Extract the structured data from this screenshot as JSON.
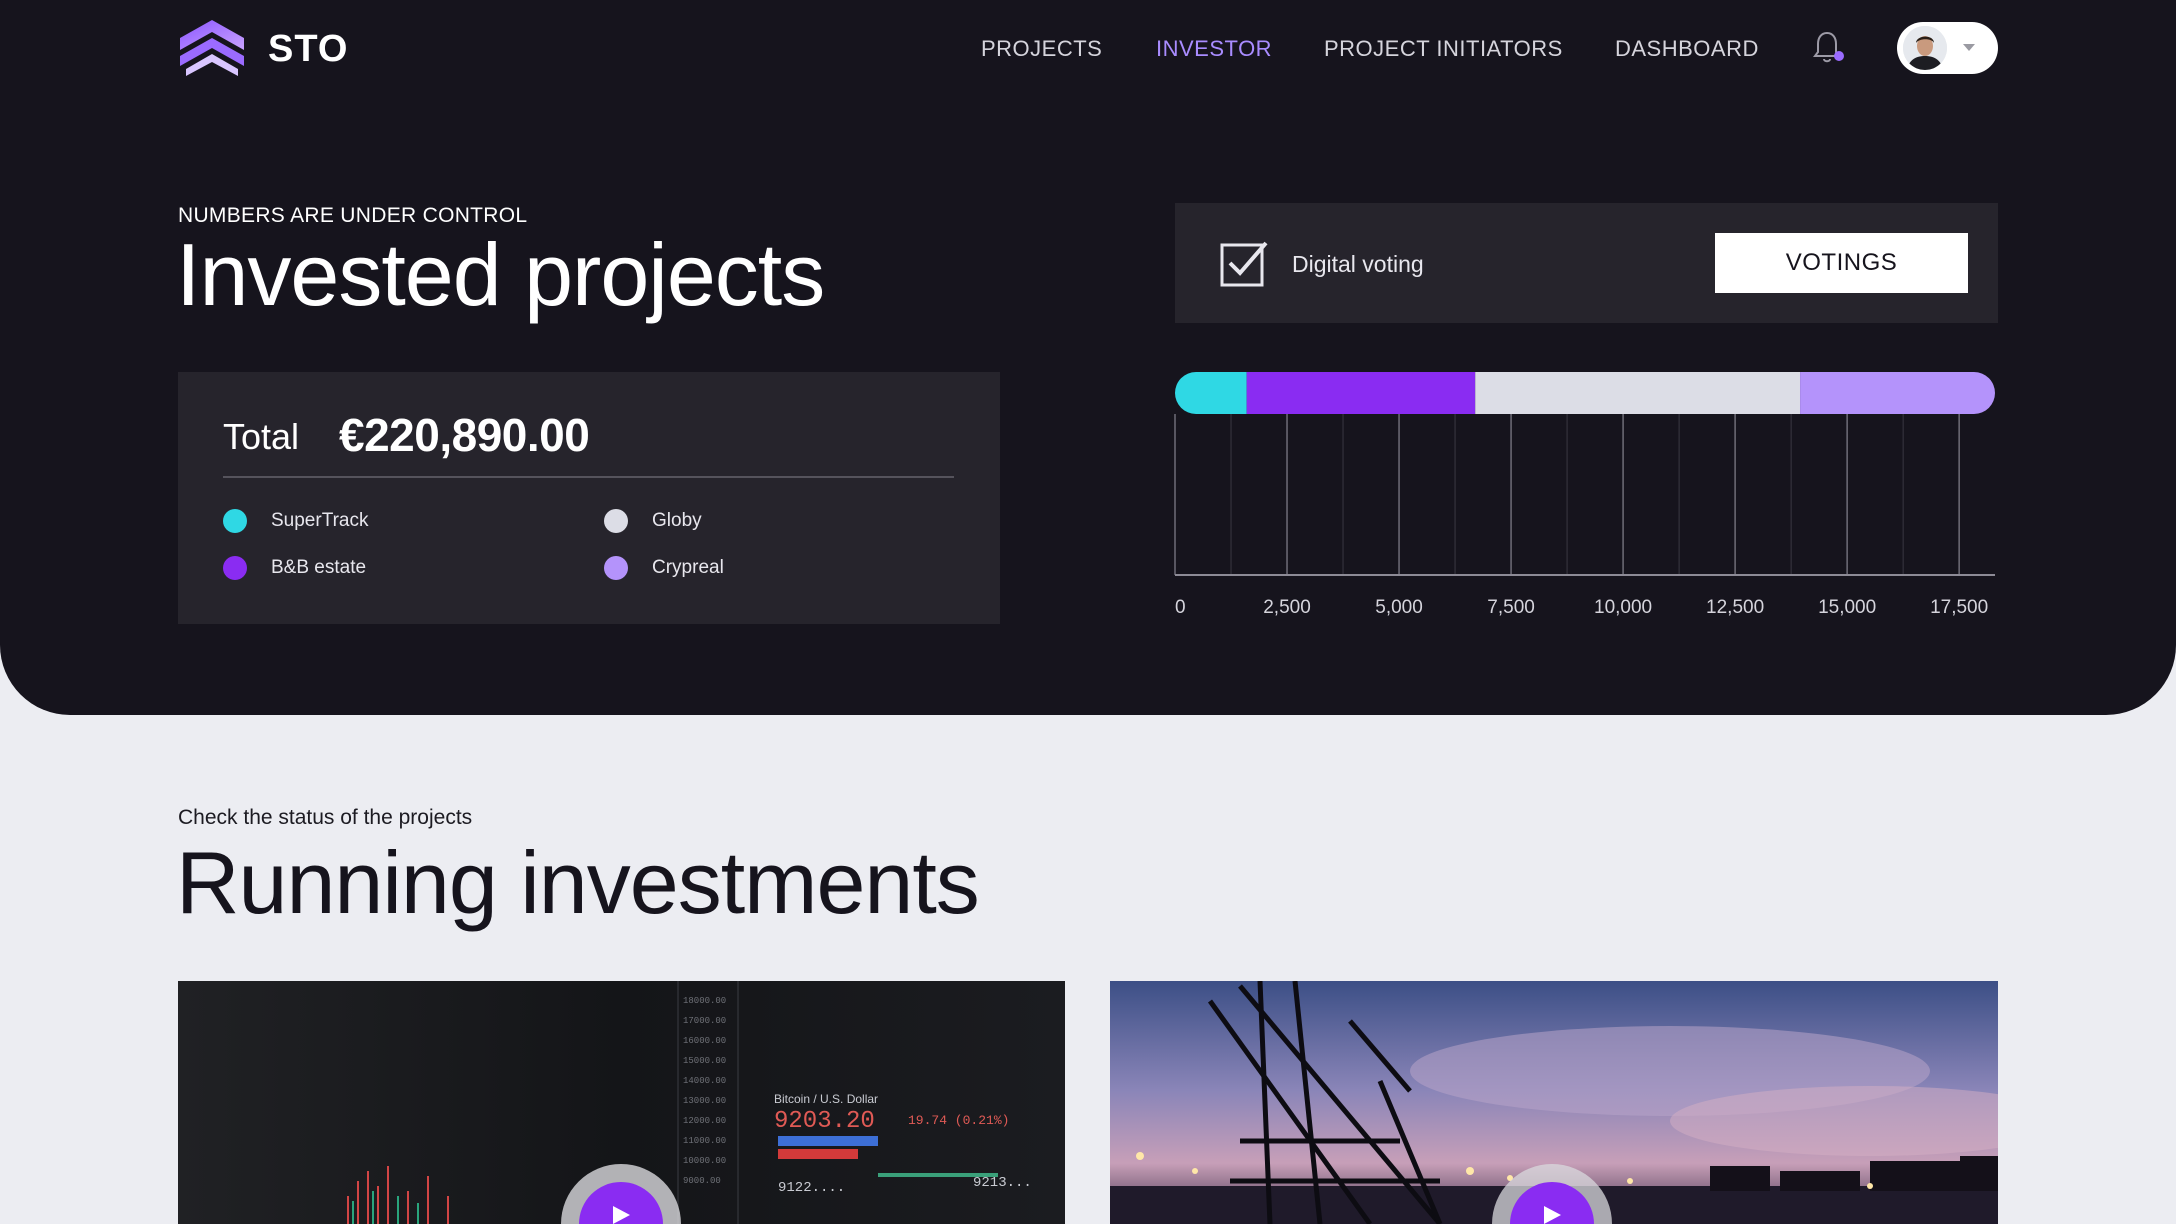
{
  "brand": {
    "name": "STO"
  },
  "nav": {
    "items": [
      {
        "label": "PROJECTS",
        "active": false
      },
      {
        "label": "INVESTOR",
        "active": true
      },
      {
        "label": "PROJECT INITIATORS",
        "active": false
      },
      {
        "label": "DASHBOARD",
        "active": false
      }
    ],
    "notification_icon": "bell-icon",
    "has_unread": true
  },
  "hero": {
    "eyebrow": "NUMBERS ARE UNDER CONTROL",
    "title": "Invested projects"
  },
  "total": {
    "label": "Total",
    "value": "€220,890.00",
    "legend": [
      {
        "name": "SuperTrack",
        "color": "#2fd8e4"
      },
      {
        "name": "Globy",
        "color": "#dcdde6"
      },
      {
        "name": "B&B estate",
        "color": "#8a2cf2"
      },
      {
        "name": "Crypreal",
        "color": "#b493fb"
      }
    ]
  },
  "voting": {
    "label": "Digital voting",
    "button": "VOTINGS",
    "icon": "checkbox-icon"
  },
  "chart_data": {
    "type": "bar",
    "orientation": "horizontal",
    "stacked": true,
    "categories": [
      ""
    ],
    "series": [
      {
        "name": "SuperTrack",
        "values": [
          1600
        ],
        "color": "#2fd8e4"
      },
      {
        "name": "B&B estate",
        "values": [
          5100
        ],
        "color": "#8a2cf2"
      },
      {
        "name": "Globy",
        "values": [
          7250
        ],
        "color": "#dcdde6"
      },
      {
        "name": "Crypreal",
        "values": [
          4350
        ],
        "color": "#b493fb"
      }
    ],
    "xlim": [
      0,
      18300
    ],
    "xticks": [
      0,
      2500,
      5000,
      7500,
      10000,
      12500,
      15000,
      17500
    ],
    "xtick_labels": [
      "0",
      "2,500",
      "5,000",
      "7,500",
      "10,000",
      "12,500",
      "15,000",
      "17,500"
    ],
    "grid": true,
    "title": "",
    "xlabel": "",
    "ylabel": ""
  },
  "running": {
    "subtitle": "Check the status of the projects",
    "title": "Running investments",
    "cards": [
      {
        "image": "trading-chart-image",
        "play_icon": "play-icon"
      },
      {
        "image": "harbor-crane-image",
        "play_icon": "play-icon"
      }
    ]
  }
}
